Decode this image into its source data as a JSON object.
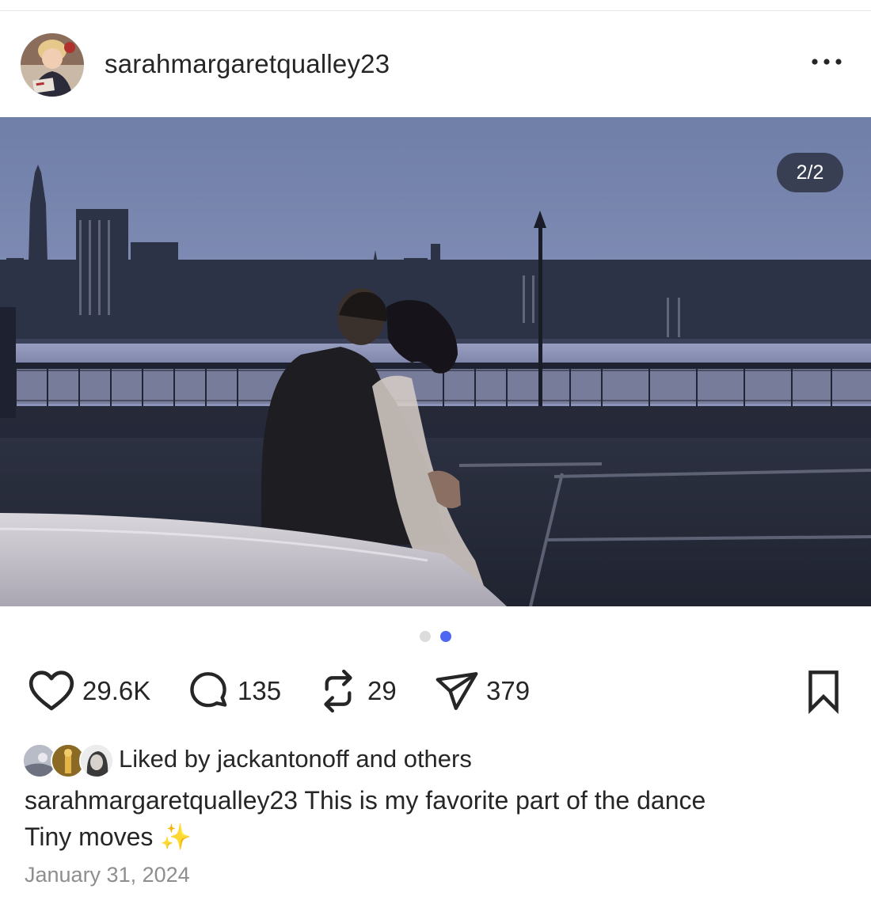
{
  "post": {
    "username": "sarahmargaretqualley23",
    "image_counter": "2/2",
    "carousel": {
      "total": 2,
      "active": 2
    },
    "stats": {
      "likes": "29.6K",
      "comments": "135",
      "reposts": "29",
      "shares": "379"
    },
    "liked_by": {
      "prefix": "Liked by",
      "user": "jackantonoff",
      "joiner": "and",
      "others": "others"
    },
    "caption": {
      "username": "sarahmargaretqualley23",
      "text": "This is my favorite part of the dance",
      "line2": "Tiny moves",
      "emoji": "✨"
    },
    "date": "January 31, 2024"
  },
  "icons": {
    "more": "more-horizontal-icon",
    "like": "heart-icon",
    "comment": "comment-bubble-icon",
    "repost": "repost-arrows-icon",
    "share": "paper-plane-icon",
    "save": "bookmark-icon"
  },
  "colors": {
    "dot_active": "#4e66f0",
    "dot_inactive": "#dcdcdc",
    "date_gray": "#8e8e8e",
    "text": "#262626"
  }
}
